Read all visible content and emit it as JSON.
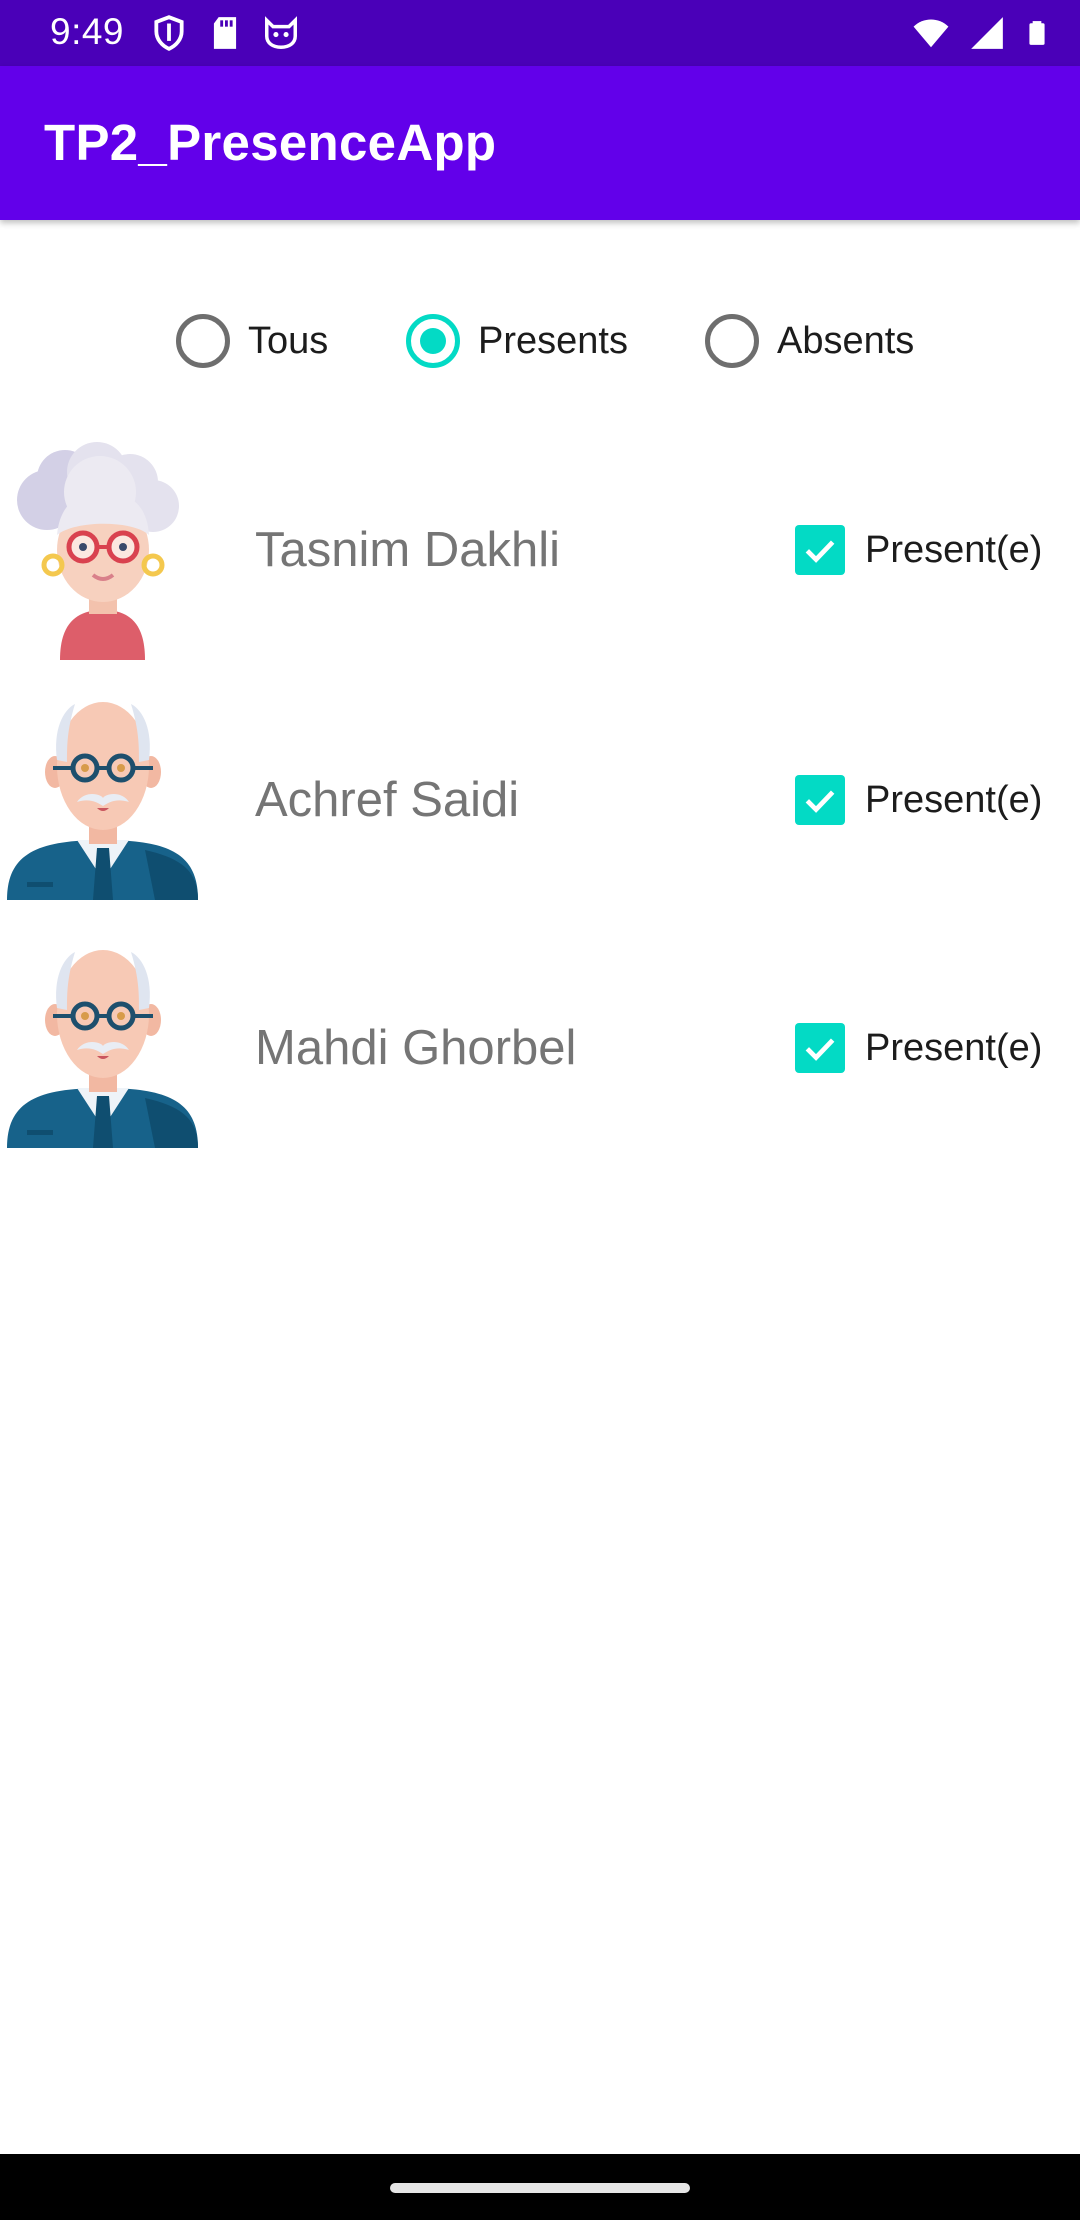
{
  "status_bar": {
    "time": "9:49",
    "left_icons": [
      "shield-icon",
      "sd-card-icon",
      "cat-face-icon"
    ],
    "right_icons": [
      "wifi-icon",
      "cellular-signal-icon",
      "battery-icon"
    ],
    "background_color": "#4a00b8"
  },
  "app_bar": {
    "title": "TP2_PresenceApp",
    "background_color": "#6200ea"
  },
  "filter": {
    "options": [
      {
        "label": "Tous",
        "checked": false
      },
      {
        "label": "Presents",
        "checked": true
      },
      {
        "label": "Absents",
        "checked": false
      }
    ],
    "accent_color": "#03dac5"
  },
  "students": [
    {
      "name": "Tasnim Dakhli",
      "avatar": "grandmother-avatar-icon",
      "present_label": "Present(e)",
      "present": true
    },
    {
      "name": "Achref Saidi",
      "avatar": "grandfather-avatar-icon",
      "present_label": "Present(e)",
      "present": true
    },
    {
      "name": "Mahdi Ghorbel",
      "avatar": "grandfather-avatar-icon",
      "present_label": "Present(e)",
      "present": true
    }
  ]
}
